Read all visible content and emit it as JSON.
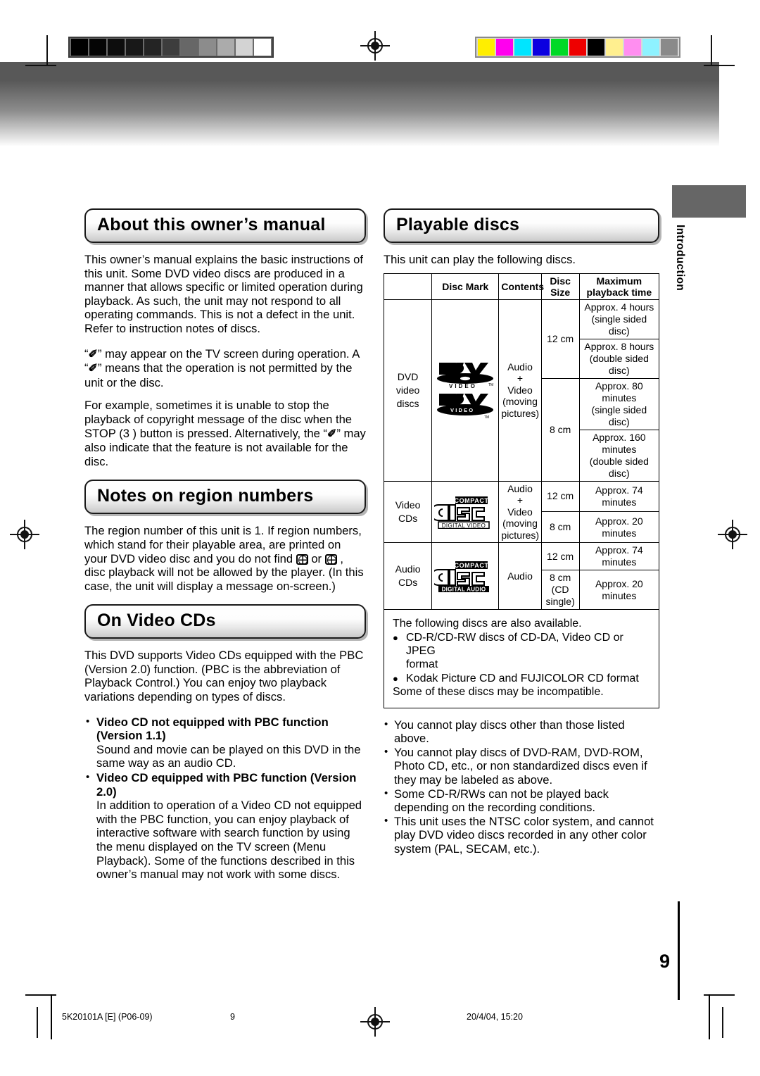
{
  "page": {
    "number": "9",
    "side_tab_label": "Introduction"
  },
  "footer": {
    "document_code": "5K20101A [E] (P06-09)",
    "page_label": "9",
    "timestamp": "20/4/04, 15:20"
  },
  "calibration": {
    "grayscale_patches": [
      "#000000",
      "#050505",
      "#0d0d0d",
      "#181818",
      "#242424",
      "#3d3d3d",
      "#676767",
      "#8c8c8c",
      "#ababab",
      "#d3d3d3",
      "#ffffff"
    ],
    "color_patches": [
      "#ffee00",
      "#ff00ee",
      "#00e5ff",
      "#0b00e0",
      "#00d926",
      "#ee0000",
      "#000000",
      "#ffef8f",
      "#ff8ef0",
      "#8ef2ff",
      "#8a8a8a"
    ]
  },
  "left_column": {
    "section_about": {
      "heading": "About this owner’s manual",
      "paragraph_1": "This owner’s manual explains the basic instructions of this unit. Some DVD video discs are produced in a manner that allows specific or limited operation during playback. As such, the unit may not respond to all operating commands. This is not a defect in the unit. Refer to instruction notes of discs.",
      "paragraph_2_a": "“",
      "paragraph_2_b": "” may appear on the TV screen during operation. A “",
      "paragraph_2_c": "” means that the operation is not permitted by the unit or the disc.",
      "paragraph_3_a": "For example, sometimes it is unable to stop the playback of copyright message of the disc when the STOP (3 ) button is pressed. Alternatively, the “",
      "paragraph_3_b": "” may also indicate that the feature is not available for the disc.",
      "forbidden_hand_symbol": "✐"
    },
    "section_region": {
      "heading": "Notes on region numbers",
      "text_a": "The region number of this unit is 1. If region numbers, which stand for their playable area, are printed on your DVD video disc and you do not find ",
      "text_b": " or ",
      "text_c": " , disc playback will not be allowed by the player. (In this case, the unit will display a message on-screen.)"
    },
    "section_videocd": {
      "heading": "On Video CDs",
      "intro": "This DVD supports Video CDs equipped with the PBC (Version 2.0) function. (PBC is the abbreviation of Playback Control.) You can enjoy two playback variations depending on types of discs.",
      "items": [
        {
          "head": "Video CD not equipped with PBC function (Version 1.1)",
          "text": "Sound and movie can be played on this DVD in the same way as an audio CD."
        },
        {
          "head": "Video CD equipped with PBC function (Version 2.0)",
          "text": "In addition to operation of a Video CD not equipped with the PBC function, you can enjoy playback of interactive software with search function by using the menu displayed on the TV screen (Menu Playback). Some of the functions described in this owner’s manual may not work with some discs."
        }
      ]
    }
  },
  "right_column": {
    "section_playable": {
      "heading": "Playable discs",
      "intro": "This unit can play the following discs."
    },
    "table": {
      "headers": {
        "blank": "",
        "disc_mark": "Disc Mark",
        "contents": "Contents",
        "disc_size": "Disc\nSize",
        "disc_size_line1": "Disc",
        "disc_size_line2": "Size",
        "maximum_line1": "Maximum",
        "maximum_line2": "playback time"
      },
      "rows": [
        {
          "label_line1": "DVD",
          "label_line2": "video",
          "label_line3": "discs",
          "marks": [
            "dvd-video-logo-outline",
            "dvd-video-logo-solid"
          ],
          "contents_line1": "Audio",
          "contents_line2": "+",
          "contents_line3": "Video",
          "contents_line4": "(moving",
          "contents_line5": "pictures)",
          "sizes": [
            {
              "size": "12 cm",
              "times": [
                {
                  "line1": "Approx. 4 hours",
                  "line2": "(single sided disc)"
                },
                {
                  "line1": "Approx. 8 hours",
                  "line2": "(double sided disc)"
                }
              ]
            },
            {
              "size": "8 cm",
              "times": [
                {
                  "line1": "Approx. 80 minutes",
                  "line2": "(single sided disc)"
                },
                {
                  "line1": "Approx. 160 minutes",
                  "line2": "(double sided disc)"
                }
              ]
            }
          ]
        },
        {
          "label_line1": "Video",
          "label_line2": "CDs",
          "marks": [
            "compact-disc-digital-video-logo"
          ],
          "logo_top": "COMPACT",
          "logo_mid": "disc",
          "logo_bottom": "DIGITAL VIDEO",
          "contents_line1": "Audio",
          "contents_line2": "+",
          "contents_line3": "Video",
          "contents_line4": "(moving",
          "contents_line5": "pictures)",
          "sizes": [
            {
              "size": "12 cm",
              "times": [
                {
                  "line1": "Approx. 74 minutes",
                  "line2": ""
                }
              ]
            },
            {
              "size": "8 cm",
              "times": [
                {
                  "line1": "Approx. 20 minutes",
                  "line2": ""
                }
              ]
            }
          ]
        },
        {
          "label_line1": "Audio",
          "label_line2": "CDs",
          "marks": [
            "compact-disc-digital-audio-logo"
          ],
          "logo_top": "COMPACT",
          "logo_mid": "disc",
          "logo_bottom": "DIGITAL AUDIO",
          "contents_line1": "Audio",
          "sizes": [
            {
              "size": "12 cm",
              "times": [
                {
                  "line1": "Approx. 74 minutes",
                  "line2": ""
                }
              ]
            },
            {
              "size_line1": "8 cm",
              "size_line2": "(CD",
              "size_line3": "single)",
              "times": [
                {
                  "line1": "Approx. 20 minutes",
                  "line2": ""
                }
              ]
            }
          ]
        }
      ]
    },
    "notes_box": {
      "intro": "The following discs are also available.",
      "bullet_1_line1": "CD-R/CD-RW discs of CD-DA, Video CD or JPEG",
      "bullet_1_line2": "format",
      "bullet_2": "Kodak Picture CD and FUJICOLOR CD format",
      "outro": "Some of these discs may be incompatible."
    },
    "endnotes": [
      "You cannot play discs other than those listed above.",
      "You cannot play discs of DVD-RAM, DVD-ROM, Photo CD, etc., or non standardized discs even if they may be labeled as above.",
      "Some CD-R/RWs can not be played back depending on the recording conditions.",
      "This unit uses the NTSC color system, and cannot play DVD video discs recorded in any other color system (PAL, SECAM, etc.)."
    ]
  }
}
